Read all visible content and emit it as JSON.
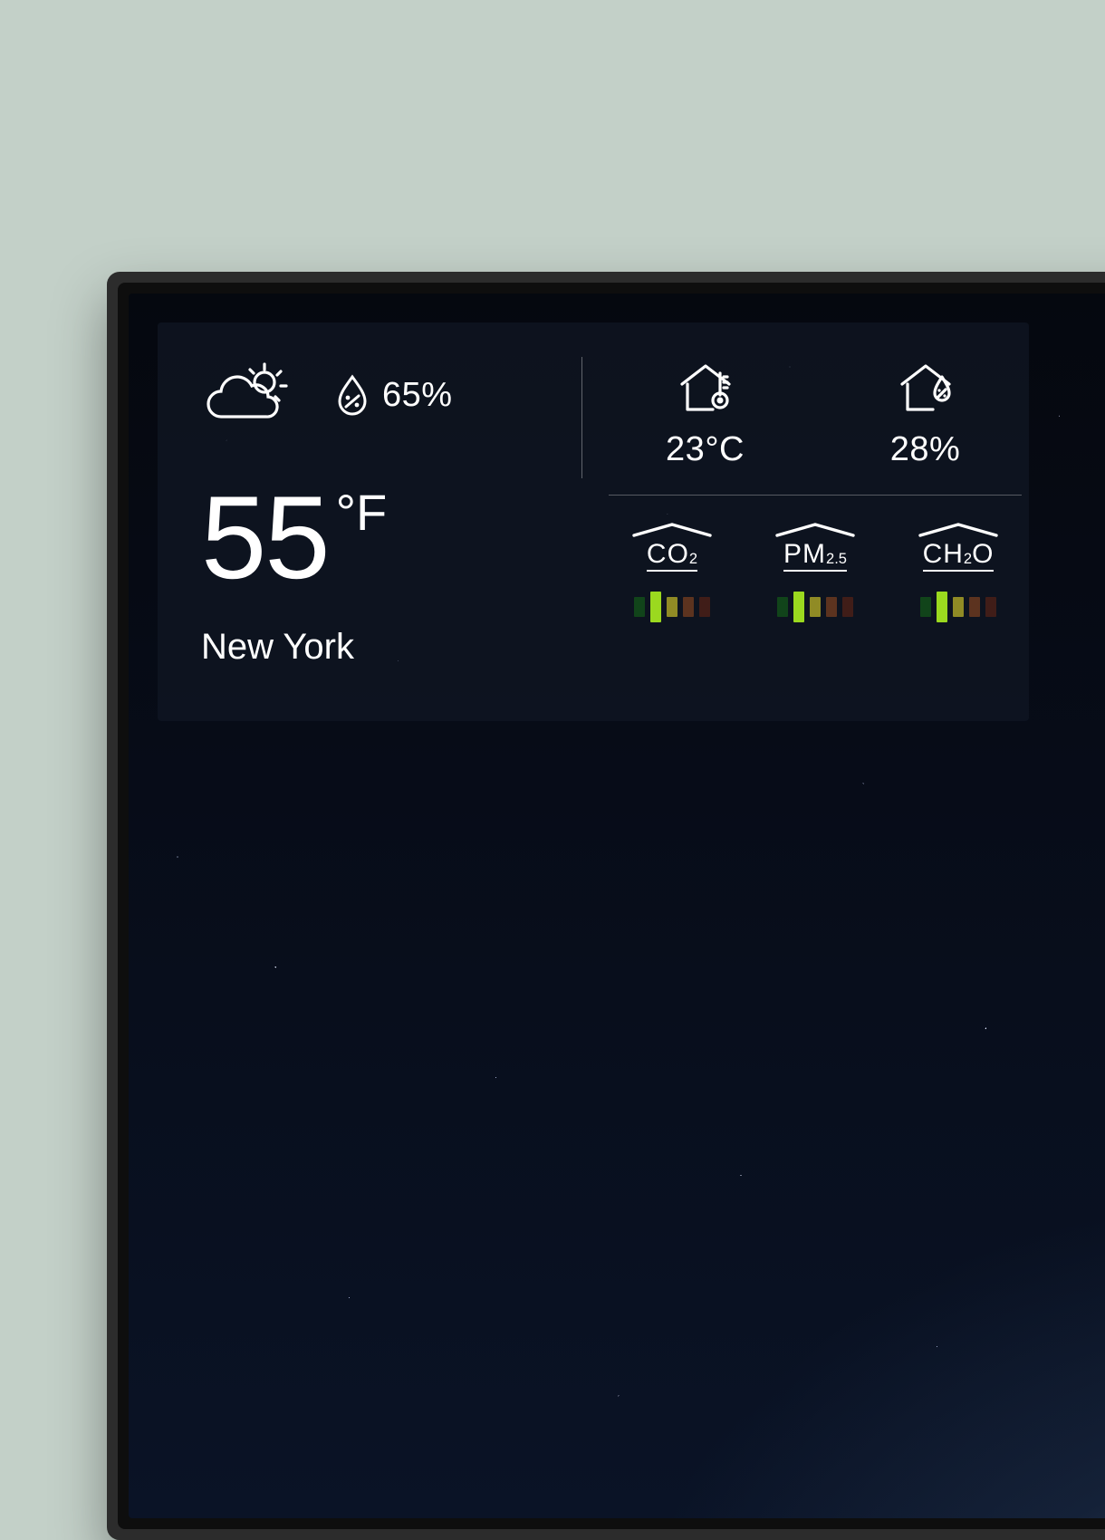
{
  "weather": {
    "condition_icon": "partly-cloudy",
    "outdoor_humidity": "65%",
    "temperature_value": "55",
    "temperature_unit": "°F",
    "location": "New York"
  },
  "indoor": {
    "temperature": "23°C",
    "humidity": "28%"
  },
  "air_quality": {
    "items": [
      {
        "label_html": "CO<sub>2</sub>",
        "active_level": 1
      },
      {
        "label_html": "PM<sub>2.5</sub>",
        "active_level": 1
      },
      {
        "label_html": "CH<sub>2</sub>O",
        "active_level": 1
      }
    ],
    "levels": 5
  }
}
